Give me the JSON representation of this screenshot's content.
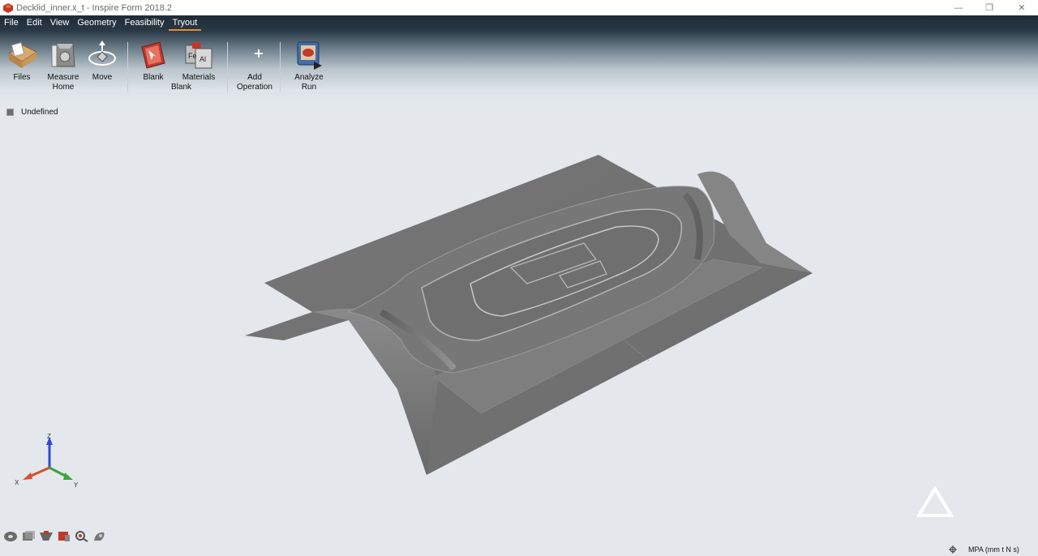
{
  "window": {
    "title": "Decklid_inner.x_t - Inspire Form 2018.2",
    "minimize_glyph": "—",
    "maximize_glyph": "❐",
    "close_glyph": "✕"
  },
  "menu": {
    "items": [
      {
        "label": "File"
      },
      {
        "label": "Edit"
      },
      {
        "label": "View"
      },
      {
        "label": "Geometry"
      },
      {
        "label": "Feasibility"
      },
      {
        "label": "Tryout",
        "active": true
      }
    ]
  },
  "ribbon": {
    "files": {
      "line1": "Files",
      "line2": ""
    },
    "measure": {
      "line1": "Measure",
      "line2": "Home"
    },
    "move": {
      "line1": "Move",
      "line2": ""
    },
    "blank": {
      "line1": "Blank",
      "line2": ""
    },
    "materials": {
      "line1": "Materials",
      "line2": ""
    },
    "blank_group_label": "Blank",
    "add_operation": {
      "line1": "Add",
      "line2": "Operation"
    },
    "analyze_run": {
      "line1": "Analyze",
      "line2": "Run"
    }
  },
  "tree": {
    "item_label": "Undefined"
  },
  "axes": {
    "x": "X",
    "y": "Y",
    "z": "Z"
  },
  "status": {
    "units": "MPA (mm t N s)"
  },
  "colors": {
    "ribbon_dark": "#1e2b36",
    "accent": "#f08a24",
    "viewport_bg": "#e4e8ec",
    "part_gray": "#7a7a7a"
  }
}
